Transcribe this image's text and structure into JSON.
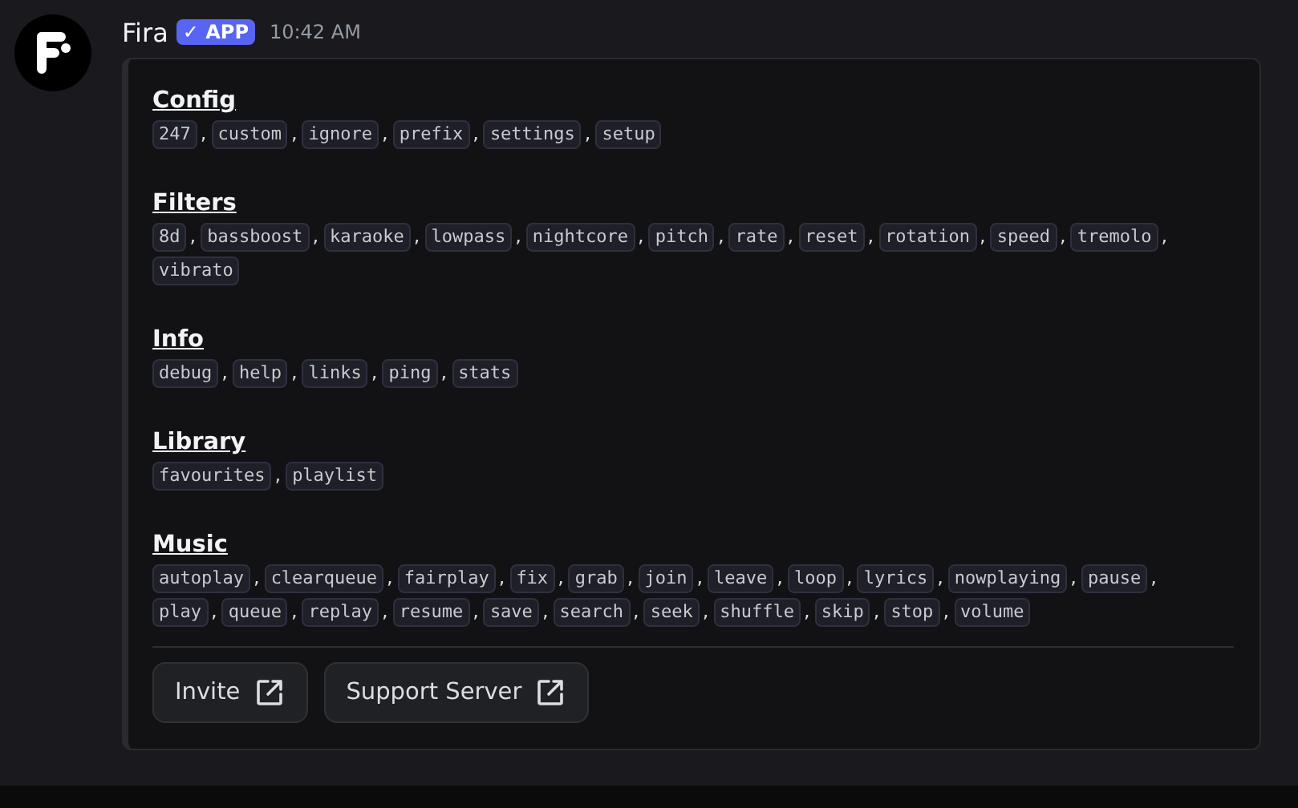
{
  "message": {
    "author": "Fira",
    "badge": {
      "check": "✓",
      "label": "APP"
    },
    "timestamp": "10:42 AM"
  },
  "embed": {
    "separator": ",",
    "sections": [
      {
        "title": "Config",
        "commands": [
          "247",
          "custom",
          "ignore",
          "prefix",
          "settings",
          "setup"
        ]
      },
      {
        "title": "Filters",
        "commands": [
          "8d",
          "bassboost",
          "karaoke",
          "lowpass",
          "nightcore",
          "pitch",
          "rate",
          "reset",
          "rotation",
          "speed",
          "tremolo",
          "vibrato"
        ]
      },
      {
        "title": "Info",
        "commands": [
          "debug",
          "help",
          "links",
          "ping",
          "stats"
        ]
      },
      {
        "title": "Library",
        "commands": [
          "favourites",
          "playlist"
        ]
      },
      {
        "title": "Music",
        "commands": [
          "autoplay",
          "clearqueue",
          "fairplay",
          "fix",
          "grab",
          "join",
          "leave",
          "loop",
          "lyrics",
          "nowplaying",
          "pause",
          "play",
          "queue",
          "replay",
          "resume",
          "save",
          "search",
          "seek",
          "shuffle",
          "skip",
          "stop",
          "volume"
        ]
      }
    ],
    "buttons": [
      {
        "label": "Invite"
      },
      {
        "label": "Support Server"
      }
    ]
  }
}
